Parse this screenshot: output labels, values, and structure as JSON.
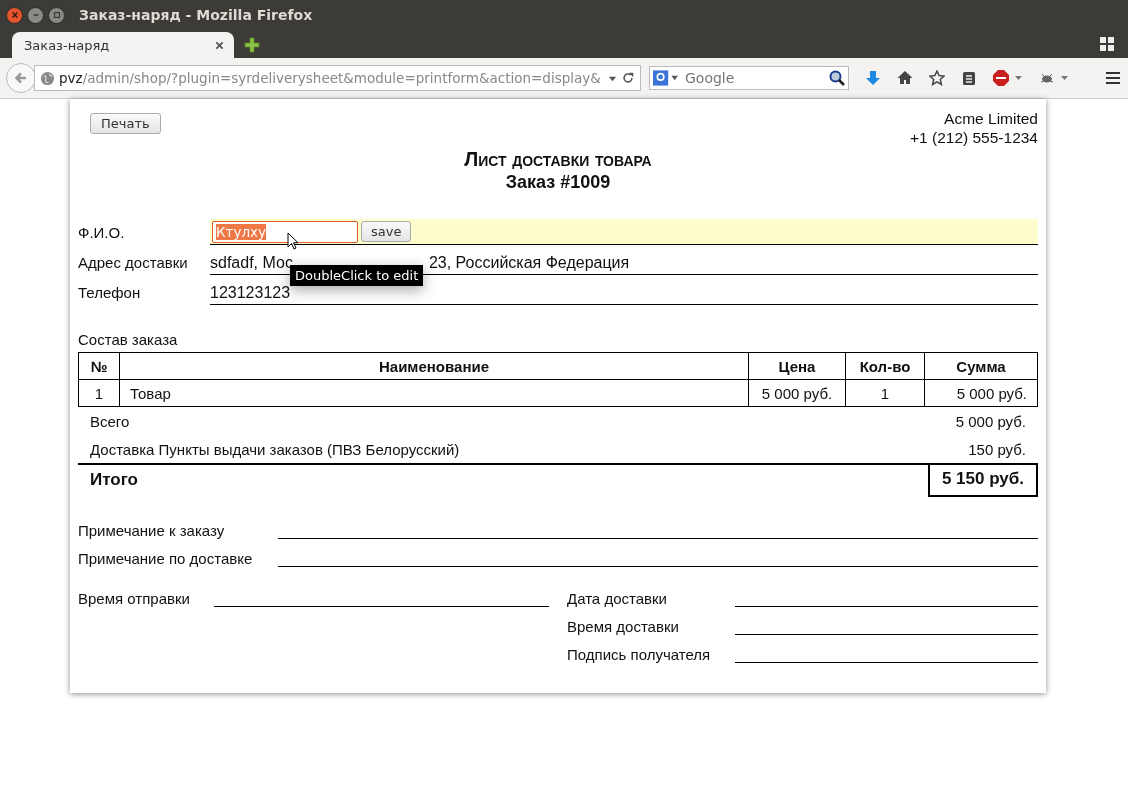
{
  "window": {
    "title": "Заказ-наряд - Mozilla Firefox"
  },
  "tabs": [
    {
      "label": "Заказ-наряд",
      "selected": true
    }
  ],
  "address_bar": {
    "host": "pvz",
    "path": "/admin/shop/?plugin=syrdeliverysheet&module=printform&action=display&"
  },
  "search": {
    "placeholder": "Google"
  },
  "page": {
    "print_button": "Печать",
    "company": {
      "name": "Acme Limited",
      "phone": "+1 (212) 555-1234"
    },
    "title": "Лист доставки товара",
    "subtitle": "Заказ #1009",
    "fields": [
      {
        "kind": "editing",
        "label": "Ф.И.О.",
        "value": "Ктулху",
        "text_selected": true,
        "button": "save"
      },
      {
        "kind": "text",
        "label": "Адрес доставки",
        "value_start": "sdfadf, Мос",
        "value_end": "23, Российская Федерация",
        "tooltip": "DoubleClick to edit"
      },
      {
        "kind": "text",
        "label": "Телефон",
        "value": "123123123"
      }
    ],
    "order_caption": "Состав заказа",
    "table": {
      "columns": [
        "№",
        "Наименование",
        "Цена",
        "Кол-во",
        "Сумма"
      ],
      "rows": [
        [
          "1",
          "Товар",
          "5 000 руб.",
          "1",
          "5 000 руб."
        ]
      ]
    },
    "summary": [
      {
        "label": "Всего",
        "value": "5 000 руб."
      },
      {
        "label": "Доставка Пункты выдачи заказов (ПВЗ Белорусский)",
        "value": "150 руб."
      }
    ],
    "total": {
      "label": "Итого",
      "value": "5 150 руб."
    },
    "notes": [
      "Примечание к заказу",
      "Примечание по доставке"
    ],
    "left_lines": [
      "Время отправки"
    ],
    "right_lines": [
      "Дата доставки",
      "Время доставки",
      "Подпись получателя"
    ]
  }
}
